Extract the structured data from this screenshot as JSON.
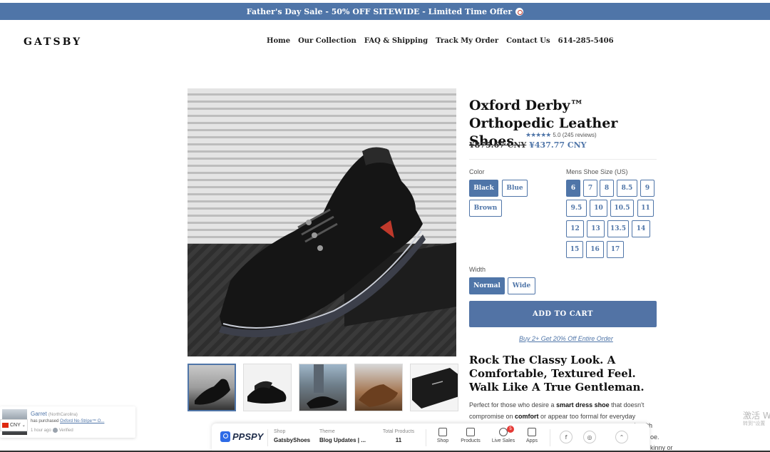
{
  "announcement": {
    "text": "Father's Day Sale - 50% OFF SITEWIDE - Limited Time Offer"
  },
  "header": {
    "logo": "GATSBY",
    "nav": [
      "Home",
      "Our Collection",
      "FAQ & Shipping",
      "Track My Order",
      "Contact Us",
      "614-285-5406"
    ]
  },
  "product": {
    "title": "Oxford Derby™ Orthopedic Leather Shoes",
    "stars": "★★★★★",
    "rating_text": "5.0 (245 reviews)",
    "old_price": "¥875.67 CNY",
    "new_price": "¥437.77 CNY",
    "color_label": "Color",
    "colors": [
      "Black",
      "Blue",
      "Brown"
    ],
    "selected_color": "Black",
    "size_label": "Mens Shoe Size (US)",
    "sizes": [
      "6",
      "7",
      "8",
      "8.5",
      "9",
      "9.5",
      "10",
      "10.5",
      "11",
      "12",
      "13",
      "13.5",
      "14",
      "15",
      "16",
      "17"
    ],
    "selected_size": "6",
    "width_label": "Width",
    "widths": [
      "Normal",
      "Wide"
    ],
    "selected_width": "Normal",
    "add_to_cart": "ADD TO CART",
    "bundle_link": "Buy 2+ Get 20% Off Entire Order",
    "headline": "Rock The Classy Look. A Comfortable, Textured Feel. Walk Like A True Gentleman.",
    "description": {
      "part1": "Perfect for those who desire a ",
      "bold1": "smart dress shoe",
      "part2": " that doesn't compromise on ",
      "bold2": "comfort",
      "part3": " or appear too formal for everyday",
      "line3": "yle with",
      "line4": "oe.",
      "line5": "kinny or"
    }
  },
  "popup": {
    "name": "Garret",
    "location": "(NorthCarolina)",
    "purchased_prefix": "has purchased ",
    "product": "Oxford No-Stripe™ O...",
    "time": "1 hour ago",
    "verified": "Verified"
  },
  "currency": {
    "code": "CNY"
  },
  "ppspy": {
    "logo": "PPSPY",
    "shop_key": "Shop",
    "shop_val": "GatsbyShoes",
    "theme_key": "Theme",
    "theme_val": "Blog Updates | ...",
    "total_key": "Total Products",
    "total_val": "11",
    "buttons": [
      "Shop",
      "Products",
      "Live Sales",
      "Apps"
    ],
    "live_badge": "5"
  },
  "watermark": {
    "line1": "激活 W",
    "line2": "转到\"设置"
  }
}
